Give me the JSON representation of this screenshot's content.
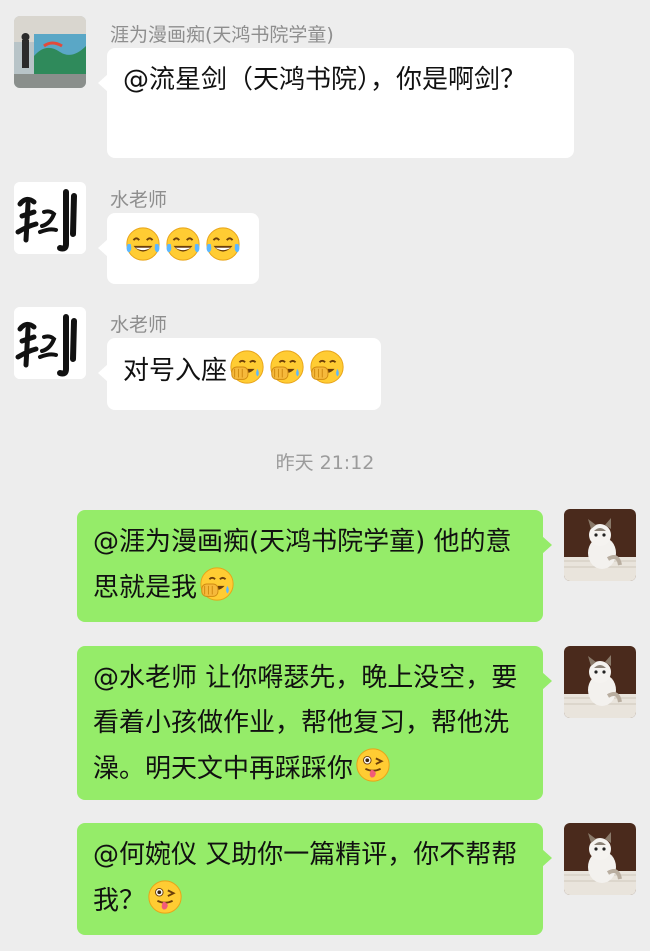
{
  "messages": [
    {
      "sender": "涯为漫画痴(天鸿书院学童)",
      "text": "@流星剑（天鸿书院），你是啊剑？",
      "emojis": []
    },
    {
      "sender": "水老师",
      "text": "",
      "emojis": [
        "tears-of-joy-emoji",
        "tears-of-joy-emoji",
        "tears-of-joy-emoji"
      ]
    },
    {
      "sender": "水老师",
      "text": "对号入座",
      "emojis": [
        "facepalm-laugh-emoji",
        "facepalm-laugh-emoji",
        "facepalm-laugh-emoji"
      ]
    }
  ],
  "timestamp": "昨天 21:12",
  "my_messages": [
    {
      "text": "@涯为漫画痴(天鸿书院学童) 他的意思就是我",
      "emojis": [
        "facepalm-laugh-emoji"
      ]
    },
    {
      "text": "@水老师  让你嘚瑟先，晚上没空，要看着小孩做作业，帮他复习，帮他洗澡。明天文中再踩踩你",
      "emojis": [
        "winking-tongue-emoji"
      ]
    },
    {
      "text": "@何婉仪  又助你一篇精评，你不帮帮我？",
      "emojis": [
        "winking-tongue-emoji"
      ]
    }
  ],
  "colors": {
    "background": "#ededed",
    "incoming_bubble": "#ffffff",
    "outgoing_bubble": "#95ec69",
    "sender_name": "#8e8e8e"
  }
}
